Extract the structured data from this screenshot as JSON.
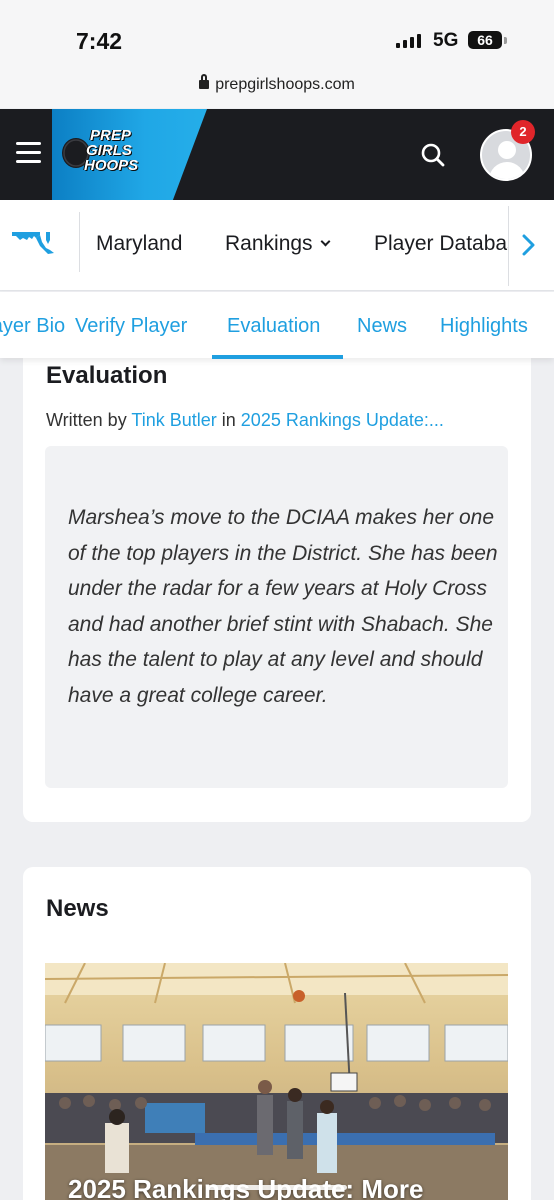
{
  "status_bar": {
    "time": "7:42",
    "network": "5G",
    "battery": "66"
  },
  "browser": {
    "url": "prepgirlshoops.com"
  },
  "header": {
    "logo_lines": [
      "PREP",
      "GIRLS",
      "HOOPS"
    ],
    "notification_count": "2"
  },
  "nav": {
    "items": [
      "Maryland",
      "Rankings",
      "Player Database"
    ]
  },
  "tabs": {
    "items": [
      "Player Bio",
      "Verify Player",
      "Evaluation",
      "News",
      "Highlights"
    ],
    "active": "Evaluation"
  },
  "evaluation": {
    "title": "Evaluation",
    "written_by": "Written by",
    "author": "Tink Butler",
    "in_text": "in",
    "article": "2025 Rankings Update:...",
    "body": "Marshea’s move to the DCIAA makes her one of the top players in the District. She has been under the radar for a few years at Holy Cross and had another brief stint with Shabach. She has the talent to play at any level and should have a great college career."
  },
  "news": {
    "title": "News",
    "headline": "2025 Rankings Update: More"
  },
  "colors": {
    "accent": "#1f9fe0",
    "header_bg": "#1b1c20",
    "badge": "#e0252a"
  }
}
